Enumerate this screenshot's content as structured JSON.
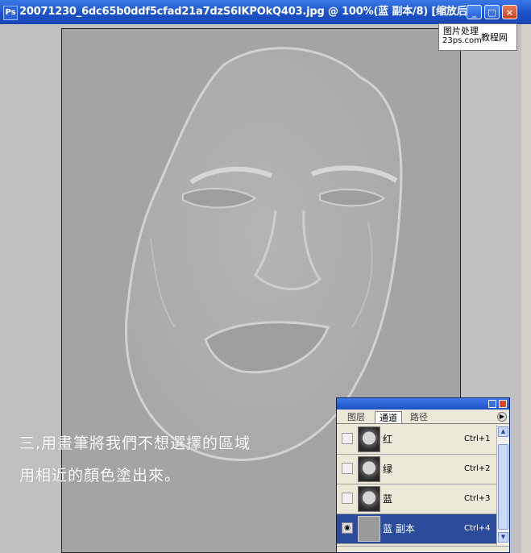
{
  "window": {
    "title": "20071230_6dc65b0ddf5cfad21a7dzS6IKPOkQ403.jpg @ 100%(蓝 副本/8) [缩放后]",
    "app_icon": "photoshop-icon"
  },
  "watermark": {
    "line1": "图片处理",
    "line2": "23ps.com",
    "line3": "教程网"
  },
  "caption": {
    "line1": "三,用畫筆將我們不想選擇的區域",
    "line2": "用相近的顏色塗出來。"
  },
  "panel": {
    "tabs": [
      {
        "label": "图层",
        "active": false
      },
      {
        "label": "通道",
        "active": true
      },
      {
        "label": "路径",
        "active": false
      }
    ],
    "channels": [
      {
        "name": "红",
        "shortcut": "Ctrl+1",
        "visible": false,
        "selected": false
      },
      {
        "name": "绿",
        "shortcut": "Ctrl+2",
        "visible": false,
        "selected": false
      },
      {
        "name": "蓝",
        "shortcut": "Ctrl+3",
        "visible": false,
        "selected": false
      },
      {
        "name": "蓝 副本",
        "shortcut": "Ctrl+4",
        "visible": true,
        "selected": true
      }
    ]
  },
  "colors": {
    "titlebar": "#1c52c8",
    "canvas": "#a4a4a4",
    "selected_row": "#2b4b9b"
  }
}
